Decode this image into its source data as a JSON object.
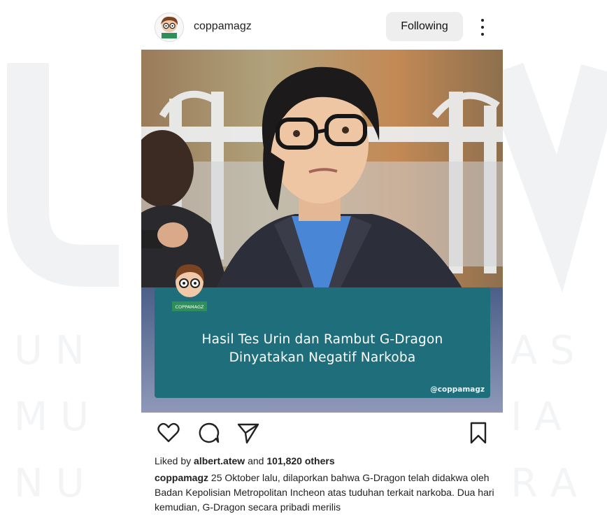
{
  "post": {
    "username": "coppamagz",
    "follow_label": "Following",
    "avatar_icon": "cartoon-avatar-icon",
    "more_icon": "more-vertical-icon"
  },
  "image": {
    "headline_line1": "Hasil Tes Urin dan Rambut G-Dragon",
    "headline_line2": "Dinyatakan Negatif Narkoba",
    "handle": "@coppamagz",
    "logo_text": "COPPAMAGZ",
    "banner_color": "#1f6e7c"
  },
  "actions": {
    "like_icon": "heart-icon",
    "comment_icon": "comment-icon",
    "share_icon": "send-icon",
    "save_icon": "bookmark-icon"
  },
  "likes": {
    "prefix": "Liked by ",
    "user": "albert.atew",
    "middle": " and ",
    "count": "101,820 others"
  },
  "caption": {
    "user": "coppamagz",
    "text": " 25 Oktober lalu, dilaporkan bahwa G-Dragon telah didakwa oleh Badan Kepolisian Metropolitan Incheon atas tuduhan terkait narkoba. Dua hari kemudian, G-Dragon secara pribadi merilis"
  }
}
